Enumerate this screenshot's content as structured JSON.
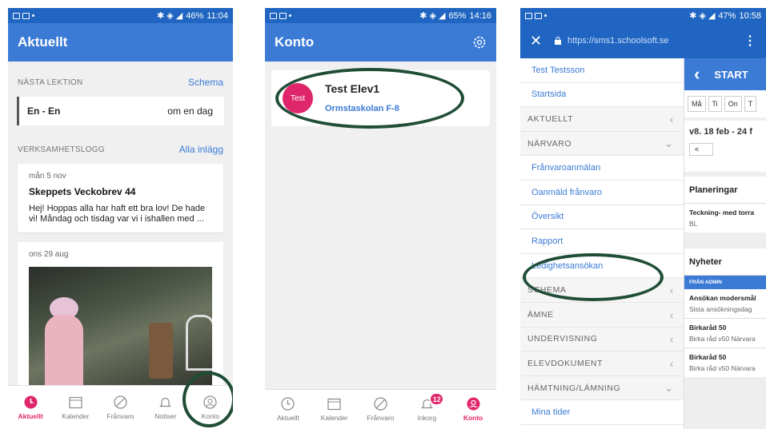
{
  "phone1": {
    "status_time": "11:04",
    "status_battery": "46%",
    "title": "Aktuellt",
    "next_lesson_label": "NÄSTA LEKTION",
    "schedule_link": "Schema",
    "lesson_subject": "En - En",
    "lesson_when": "om en dag",
    "log_label": "VERKSAMHETSLOGG",
    "all_posts_link": "Alla inlägg",
    "post1": {
      "date": "mån 5 nov",
      "title": "Skeppets Veckobrev 44",
      "text": "Hej!  Hoppas alla har haft ett bra lov! De hade vi!  Måndag och tisdag var vi i ishallen med ..."
    },
    "post2": {
      "date": "ons 29 aug"
    },
    "nav": [
      "Aktuellt",
      "Kalender",
      "Frånvaro",
      "Notiser",
      "Konto"
    ]
  },
  "phone2": {
    "status_time": "14:16",
    "status_battery": "65%",
    "title": "Konto",
    "avatar_text": "Test",
    "account_name": "Test Elev1",
    "school": "Ormstaskolan F-8",
    "nav": [
      "Aktuellt",
      "Kalender",
      "Frånvaro",
      "Inkorg",
      "Konto"
    ],
    "inbox_badge": "12"
  },
  "phone3": {
    "status_time": "10:58",
    "status_battery": "47%",
    "url": "https://sms1.schoolsoft.se",
    "menu": [
      {
        "label": "Test Testsson",
        "type": "link"
      },
      {
        "label": "Startsida",
        "type": "link"
      },
      {
        "label": "AKTUELLT",
        "type": "section",
        "chev": "‹"
      },
      {
        "label": "NÄRVARO",
        "type": "section",
        "chev": "⌄"
      },
      {
        "label": "Frånvaroanmälan",
        "type": "link"
      },
      {
        "label": "Oanmäld frånvaro",
        "type": "link"
      },
      {
        "label": "Översikt",
        "type": "link"
      },
      {
        "label": "Rapport",
        "type": "link"
      },
      {
        "label": "Ledighetsansökan",
        "type": "link"
      },
      {
        "label": "SCHEMA",
        "type": "section",
        "chev": "‹"
      },
      {
        "label": "ÄMNE",
        "type": "section",
        "chev": "‹"
      },
      {
        "label": "UNDERVISNING",
        "type": "section",
        "chev": "‹"
      },
      {
        "label": "ELEVDOKUMENT",
        "type": "section",
        "chev": "‹"
      },
      {
        "label": "HÄMTNING/LÄMNING",
        "type": "section",
        "chev": "⌄"
      },
      {
        "label": "Mina tider",
        "type": "link"
      }
    ],
    "content": {
      "header": "START",
      "days": [
        "Må",
        "Ti",
        "On",
        "T"
      ],
      "week": "v8. 18 feb - 24 f",
      "week_nav": "<",
      "planning_title": "Planeringar",
      "planning_item": "Teckning- med torra",
      "planning_sub": "BL",
      "news_title": "Nyheter",
      "news_tag": "FRÅN ADMIN",
      "news1_title": "Ansökan modersmål",
      "news1_sub": "Sista ansökningsdag",
      "news2_title": "Birkaråd 50",
      "news2_sub": "Birka råd v50 Närvara",
      "news3_title": "Birkaråd 50",
      "news3_sub": "Birka råd v50 Närvara"
    }
  },
  "colors": {
    "brand": "#3b7bd6",
    "statusbar": "#1f65c1",
    "accent": "#e0266b",
    "highlight_ring": "#1f4d36"
  }
}
